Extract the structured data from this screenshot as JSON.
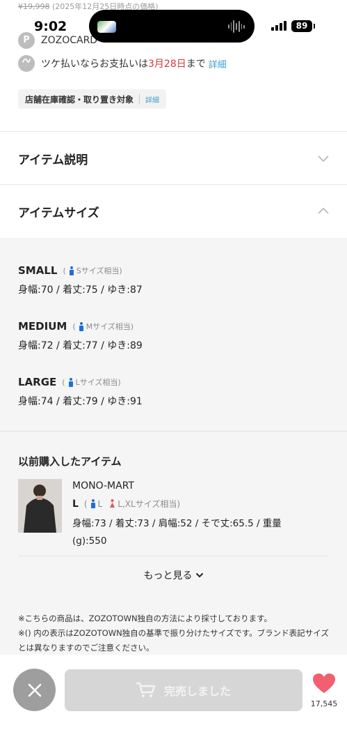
{
  "status_bar": {
    "time": "9:02",
    "battery": "89"
  },
  "price": {
    "old_price": "¥19,998",
    "note": "(2025年12月25日時点の価格)"
  },
  "points": {
    "card_text": "ZOZOCARD",
    "card_icon_letter": "P",
    "tsuke_prefix": "ツケ払いならお支払いは",
    "tsuke_date": "3月28日",
    "tsuke_suffix": "まで",
    "tsuke_link": "詳細"
  },
  "store_badge": {
    "label": "店舗在庫確認・取り置き対象",
    "link": "詳細"
  },
  "accordion": {
    "description_title": "アイテム説明",
    "size_title": "アイテムサイズ"
  },
  "sizes": [
    {
      "name": "SMALL",
      "equiv": "Sサイズ相当",
      "measurements": "身幅:70 / 着丈:75 / ゆき:87"
    },
    {
      "name": "MEDIUM",
      "equiv": "Mサイズ相当",
      "measurements": "身幅:72 / 着丈:77 / ゆき:89"
    },
    {
      "name": "LARGE",
      "equiv": "Lサイズ相当",
      "measurements": "身幅:74 / 着丈:79 / ゆき:91"
    }
  ],
  "previous": {
    "title": "以前購入したアイテム",
    "brand": "MONO-MART",
    "size": "L",
    "male_equiv": "L",
    "female_equiv": "L,XLサイズ相当",
    "measurements": "身幅:73 / 着丈:73 / 肩幅:52 / そで丈:65.5 / 重量(g):550",
    "more_label": "もっと見る"
  },
  "notes": [
    "※こちらの商品は、ZOZOTOWN独自の方法により採寸しております。",
    "※() 内の表示はZOZOTOWN独自の基準で振り分けたサイズです。ブランド表記サイズとは異なりますのでご注意ください。"
  ],
  "bottom": {
    "sold_out_label": "完売しました",
    "favorite_count": "17,545"
  },
  "colors": {
    "male_icon": "#1f6fd6",
    "female_icon": "#e0565c",
    "heart": "#f0606e",
    "link": "#3aa0d0",
    "accent_red": "#d6373b"
  }
}
